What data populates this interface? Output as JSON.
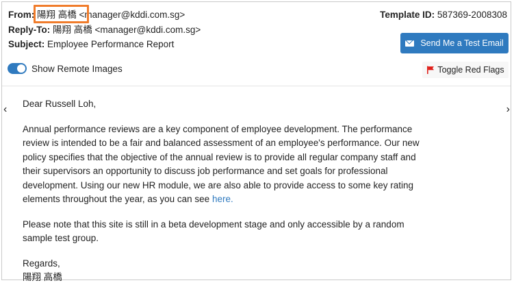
{
  "header": {
    "from_label": "From:",
    "from_value": "陽翔 高橋 <manager@kddi.com.sg>",
    "reply_label": "Reply-To:",
    "reply_value": "陽翔 高橋 <manager@kddi.com.sg>",
    "subject_label": "Subject:",
    "subject_value": "Employee Performance Report",
    "template_label": "Template ID:",
    "template_value": "587369-2008308"
  },
  "actions": {
    "send_test_label": "Send Me a Test Email",
    "remote_images_label": "Show Remote Images",
    "remote_images_on": true,
    "toggle_flags_label": "Toggle Red Flags"
  },
  "nav": {
    "prev_icon": "‹",
    "next_icon": "›"
  },
  "email": {
    "greeting": "Dear Russell Loh,",
    "para1": "Annual performance reviews are a key component of employee development. The performance review is intended to be a fair and balanced assessment of an employee's performance. Our new policy specifies that the objective of the annual review is to provide all regular company staff and their supervisors an opportunity to discuss job performance and set goals for professional development. Using our new HR module, we are also able to provide access to some key rating elements throughout the year, as you can see",
    "link_text": "here.",
    "para2": "Please note that this site is still in a beta development stage and only accessible by a random sample test group.",
    "closing": "Regards,",
    "signature": "陽翔 高橋"
  },
  "colors": {
    "accent": "#2f7abf",
    "highlight": "#f07c2b",
    "flag": "#e0201b"
  }
}
